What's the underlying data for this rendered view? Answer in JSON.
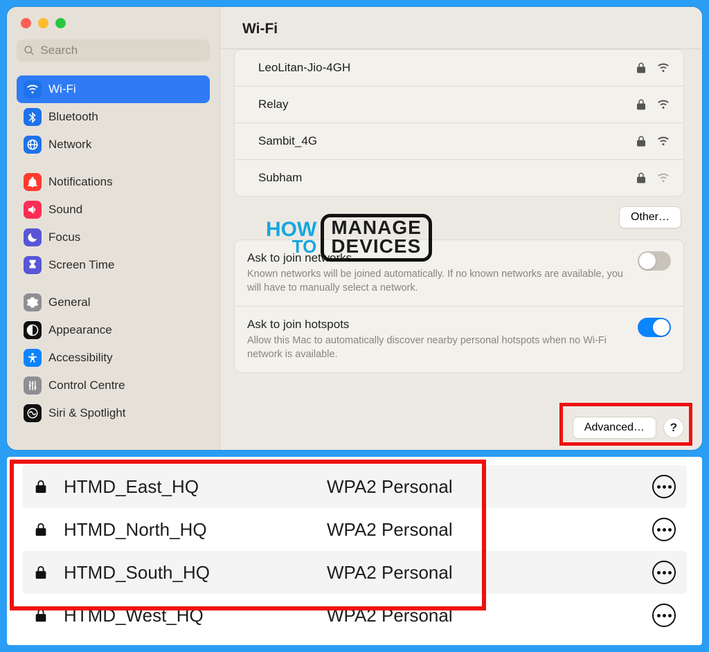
{
  "header": {
    "title": "Wi-Fi"
  },
  "search": {
    "placeholder": "Search"
  },
  "sidebar": {
    "groups": [
      [
        {
          "label": "Wi-Fi",
          "icon": "wifi",
          "bg": "#1e72ea",
          "selected": true
        },
        {
          "label": "Bluetooth",
          "icon": "bluetooth",
          "bg": "#1e72ea"
        },
        {
          "label": "Network",
          "icon": "globe",
          "bg": "#1e72ea"
        }
      ],
      [
        {
          "label": "Notifications",
          "icon": "bell",
          "bg": "#ff3b30"
        },
        {
          "label": "Sound",
          "icon": "sound",
          "bg": "#ff2d55"
        },
        {
          "label": "Focus",
          "icon": "moon",
          "bg": "#5856d6"
        },
        {
          "label": "Screen Time",
          "icon": "hour",
          "bg": "#5856d6"
        }
      ],
      [
        {
          "label": "General",
          "icon": "gear",
          "bg": "#8e8e93"
        },
        {
          "label": "Appearance",
          "icon": "appear",
          "bg": "#111"
        },
        {
          "label": "Accessibility",
          "icon": "access",
          "bg": "#0a84ff"
        },
        {
          "label": "Control Centre",
          "icon": "control",
          "bg": "#8e8e93"
        },
        {
          "label": "Siri & Spotlight",
          "icon": "siri",
          "bg": "#111"
        }
      ]
    ]
  },
  "networks": [
    {
      "name": "LeoLitan-Jio-4GH",
      "locked": true,
      "strength": "full"
    },
    {
      "name": "Relay",
      "locked": true,
      "strength": "full"
    },
    {
      "name": "Sambit_4G",
      "locked": true,
      "strength": "full"
    },
    {
      "name": "Subham",
      "locked": true,
      "strength": "weak"
    }
  ],
  "buttons": {
    "other": "Other…",
    "advanced": "Advanced…",
    "help": "?"
  },
  "settings": {
    "ask_networks": {
      "title": "Ask to join networks",
      "desc": "Known networks will be joined automatically. If no known networks are available, you will have to manually select a network.",
      "on": false
    },
    "ask_hotspots": {
      "title": "Ask to join hotspots",
      "desc": "Allow this Mac to automatically discover nearby personal hotspots when no Wi-Fi network is available.",
      "on": true
    }
  },
  "known_networks": [
    {
      "name": "HTMD_East_HQ",
      "security": "WPA2 Personal"
    },
    {
      "name": "HTMD_North_HQ",
      "security": "WPA2 Personal"
    },
    {
      "name": "HTMD_South_HQ",
      "security": "WPA2 Personal"
    },
    {
      "name": "HTMD_West_HQ",
      "security": "WPA2 Personal"
    }
  ],
  "watermark": {
    "line1": "HOW",
    "line2": "TO",
    "box1": "MANAGE",
    "box2": "DEVICES"
  }
}
